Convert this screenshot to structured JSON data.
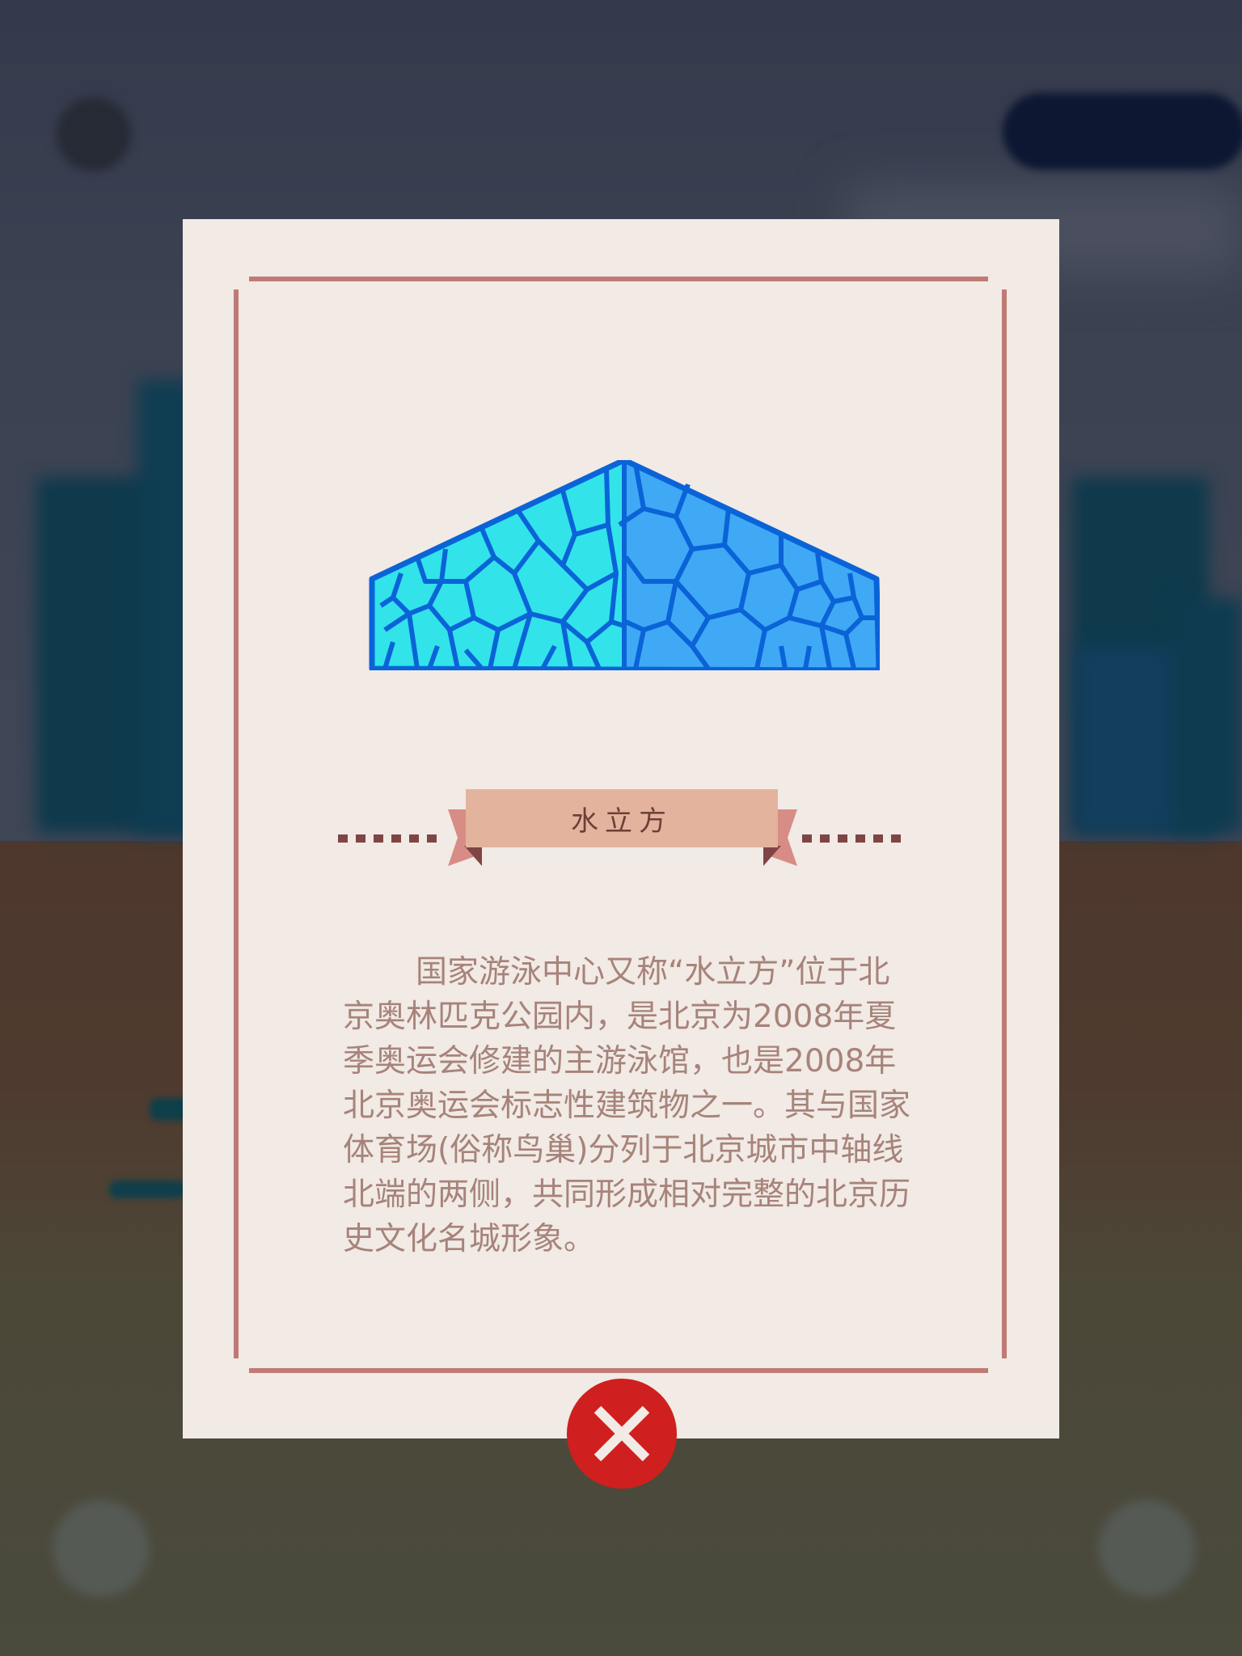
{
  "colors": {
    "card_background": "#f1eae5",
    "frame": "#c07a76",
    "ribbon": "#e3b39d",
    "title_text": "#6d3f38",
    "body_text": "#a7837a",
    "close_button": "#d01f1f",
    "cube_light": "#32e3ea",
    "cube_dark": "#3fa9f5",
    "cube_stroke": "#0b63d8"
  },
  "modal": {
    "title": "水立方",
    "illustration_icon": "water-cube-icon",
    "description": "国家游泳中心又称“水立方”位于北京奥林匹克公园内，是北京为2008年夏季奥运会修建的主游泳馆，也是2008年北京奥运会标志性建筑物之一。其与国家体育场(俗称鸟巢)分列于北京城市中轴线北端的两侧，共同形成相对完整的北京历史文化名城形象。",
    "close_icon": "close-icon"
  },
  "background": {
    "top_left_button_icon": "circle-button-icon",
    "top_right_button_icon": "pill-button-icon",
    "bottom_left_button_icon": "circle-button-icon",
    "bottom_right_button_icon": "circle-button-icon"
  }
}
